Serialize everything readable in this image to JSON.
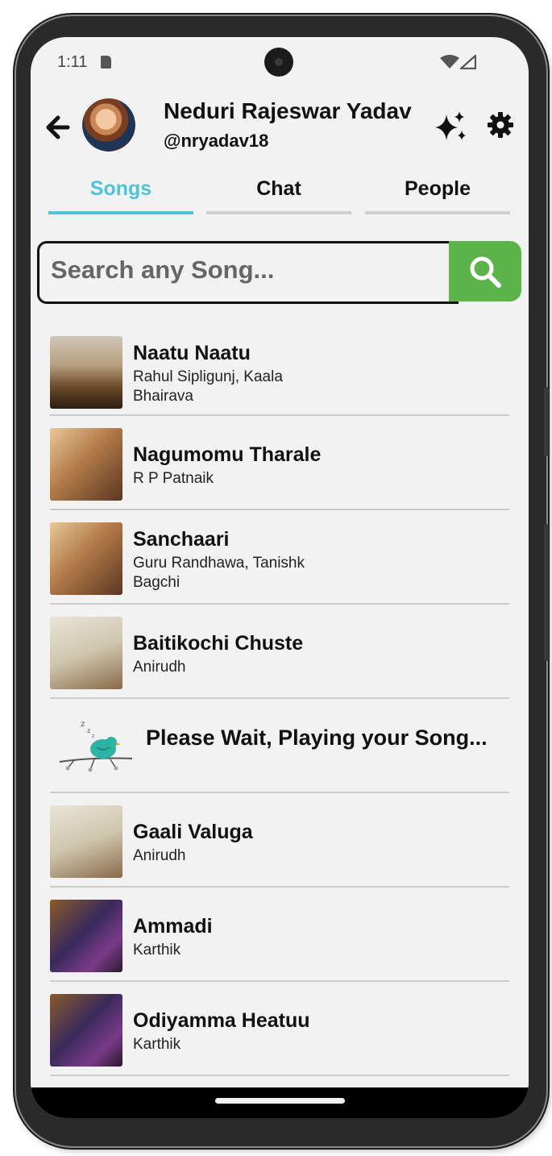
{
  "status_bar": {
    "time": "1:11"
  },
  "header": {
    "user_name": "Neduri Rajeswar Yadav",
    "user_handle": "@nryadav18"
  },
  "tabs": [
    {
      "label": "Songs",
      "active": true
    },
    {
      "label": "Chat",
      "active": false
    },
    {
      "label": "People",
      "active": false
    }
  ],
  "search": {
    "placeholder": "Search any Song..."
  },
  "songs": [
    {
      "title": "Naatu Naatu",
      "artist": "Rahul Sipligunj, Kaala Bhairava"
    },
    {
      "title": "Nagumomu Tharale",
      "artist": "R P Patnaik"
    },
    {
      "title": "Sanchaari",
      "artist": "Guru Randhawa, Tanishk Bagchi"
    },
    {
      "title": "Baitikochi Chuste",
      "artist": "Anirudh"
    },
    {
      "title": "Gaali Valuga",
      "artist": "Anirudh"
    },
    {
      "title": "Ammadi",
      "artist": "Karthik"
    },
    {
      "title": "Odiyamma Heatuu",
      "artist": "Karthik"
    }
  ],
  "loading": {
    "message": "Please Wait, Playing your Song..."
  },
  "colors": {
    "accent_tab": "#4fc3d8",
    "search_button": "#5cb34a",
    "background": "#f2f2f2"
  }
}
